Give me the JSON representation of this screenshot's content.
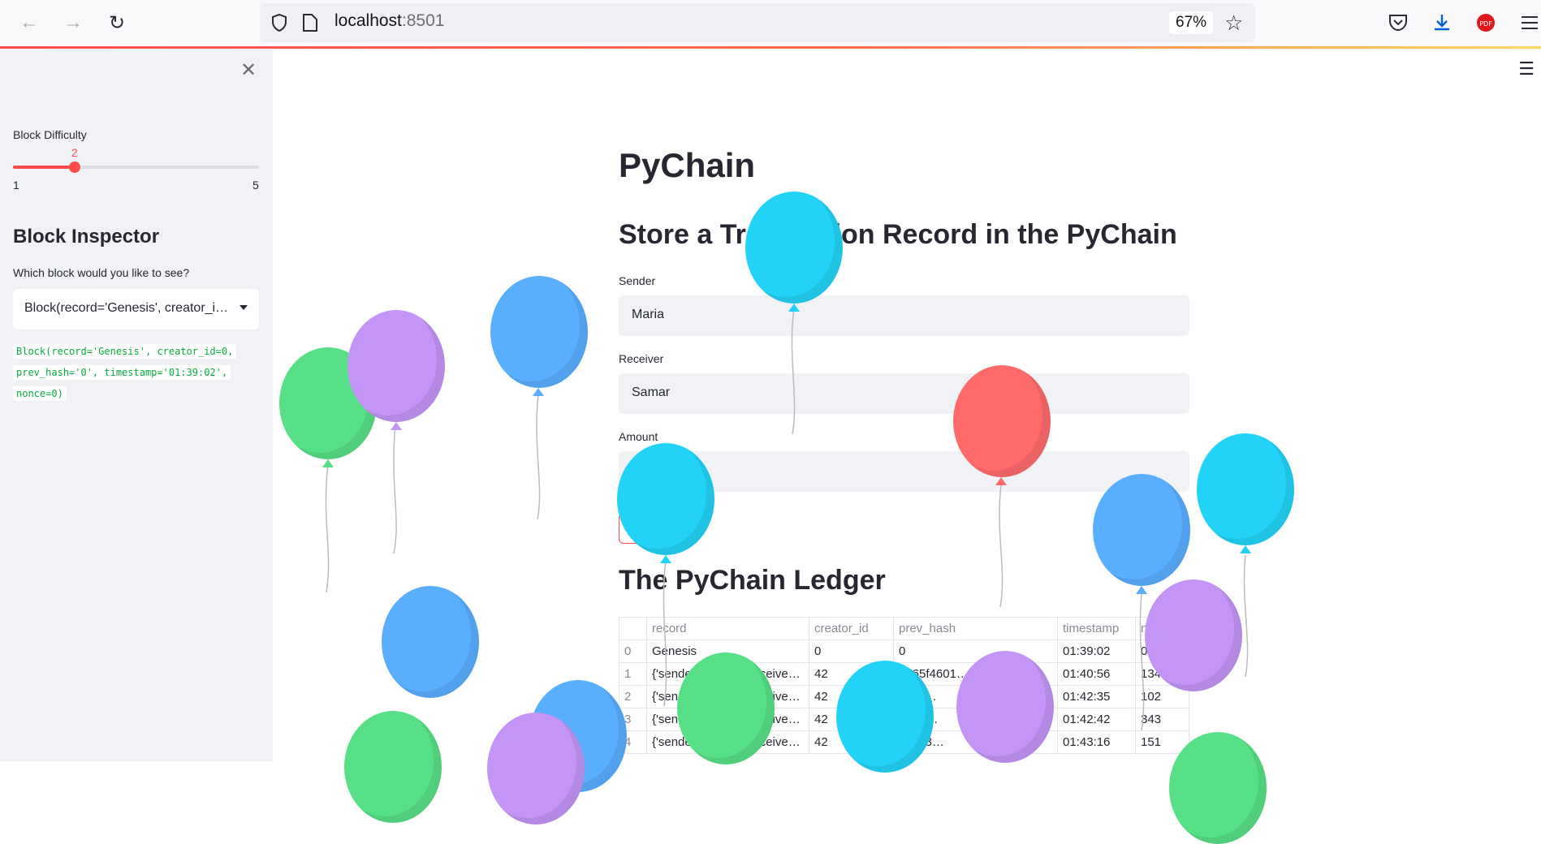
{
  "browser": {
    "url_host": "localhost",
    "url_port": ":8501",
    "zoom": "67%"
  },
  "sidebar": {
    "slider_label": "Block Difficulty",
    "slider_value": "2",
    "slider_min": "1",
    "slider_max": "5",
    "slider_fraction": 0.25,
    "inspector_title": "Block Inspector",
    "select_label": "Which block would you like to see?",
    "select_value": "Block(record='Genesis', creator_id=0, prev_hash='0', timestamp='01:39:02', nonce=0)",
    "code_lines": [
      "Block(record='Genesis', creator_id=0,",
      "prev_hash='0', timestamp='01:39:02',",
      "nonce=0)"
    ]
  },
  "main": {
    "title": "PyChain",
    "subtitle": "Store a Transaction Record in the PyChain",
    "sender_label": "Sender",
    "sender_value": "Maria",
    "receiver_label": "Receiver",
    "receiver_value": "Samar",
    "amount_label": "Amount",
    "amount_value": "",
    "ledger_title": "The PyChain Ledger",
    "table": {
      "columns": [
        "",
        "record",
        "creator_id",
        "prev_hash",
        "timestamp",
        "nonce"
      ],
      "rows": [
        [
          "0",
          "Genesis",
          "0",
          "0",
          "01:39:02",
          "0"
        ],
        [
          "1",
          "{'sender': 'Maria', 'receive…",
          "42",
          "2765f4601…",
          "01:40:56",
          "134"
        ],
        [
          "2",
          "{'sender': 'Maria', 'receive…",
          "42",
          "c98c…",
          "01:42:35",
          "102"
        ],
        [
          "3",
          "{'sender': 'Maria', 'receive…",
          "42",
          "bee9…",
          "01:42:42",
          "343"
        ],
        [
          "4",
          "{'sender': 'Maria', 'receive…",
          "42",
          "bc513…",
          "01:43:16",
          "151"
        ]
      ]
    }
  },
  "colors": {
    "accent": "#ff4b4b",
    "balloon_cyan": "#22d3f7",
    "balloon_blue": "#5aaeff",
    "balloon_purple": "#c495f7",
    "balloon_green": "#57e085",
    "balloon_red": "#ff6b6b"
  }
}
